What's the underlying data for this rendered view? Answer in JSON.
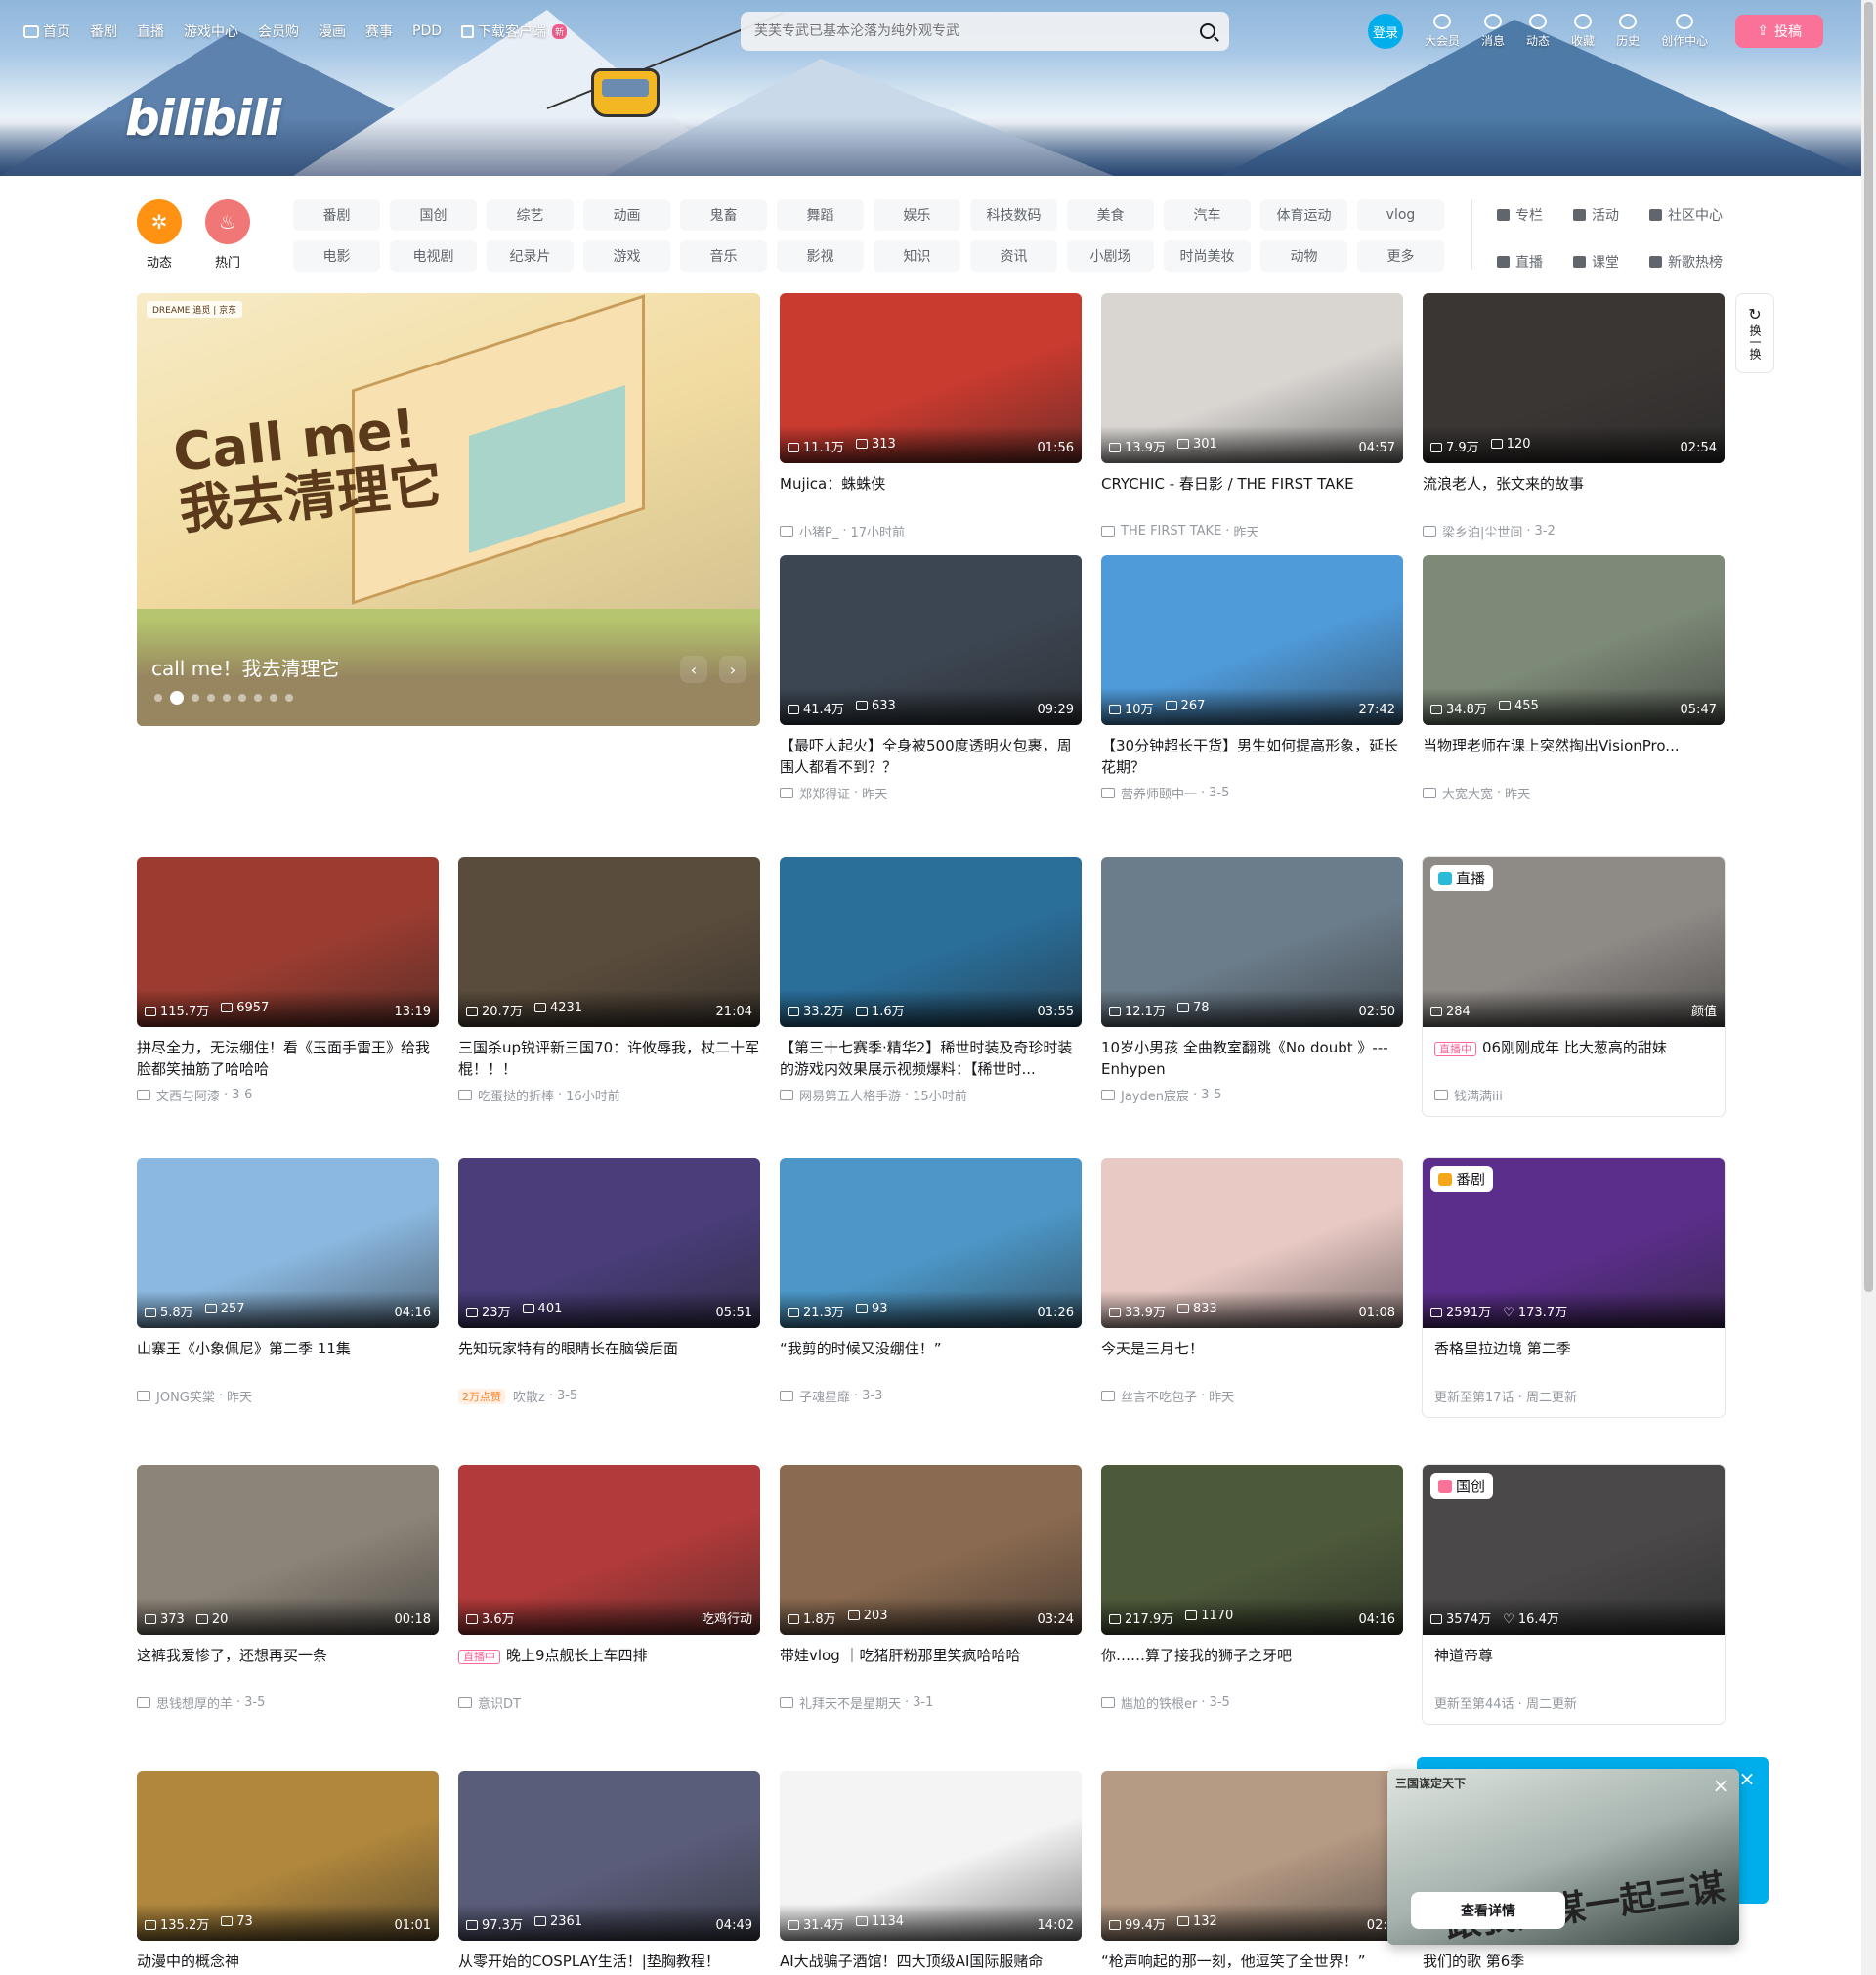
{
  "nav": {
    "items": [
      {
        "label": "首页",
        "icon": "tv-icon"
      },
      {
        "label": "番剧"
      },
      {
        "label": "直播"
      },
      {
        "label": "游戏中心"
      },
      {
        "label": "会员购"
      },
      {
        "label": "漫画"
      },
      {
        "label": "赛事"
      },
      {
        "label": "PDD"
      },
      {
        "label": "下载客户端",
        "icon": "download-icon",
        "badge": "新"
      }
    ],
    "search_placeholder": "芙芙专武已基本沦落为纯外观专武",
    "login": "登录",
    "right": [
      {
        "label": "大会员",
        "icon": "vip-icon"
      },
      {
        "label": "消息",
        "icon": "message-icon"
      },
      {
        "label": "动态",
        "icon": "dynamic-icon"
      },
      {
        "label": "收藏",
        "icon": "star-icon"
      },
      {
        "label": "历史",
        "icon": "clock-icon"
      },
      {
        "label": "创作中心",
        "icon": "bulb-icon"
      }
    ],
    "upload": "投稿",
    "logo": "bilibili"
  },
  "channels": {
    "dynamic": "动态",
    "hot": "热门",
    "row1": [
      "番剧",
      "国创",
      "综艺",
      "动画",
      "鬼畜",
      "舞蹈",
      "娱乐",
      "科技数码",
      "美食",
      "汽车",
      "体育运动",
      "vlog"
    ],
    "row2": [
      "电影",
      "电视剧",
      "纪录片",
      "游戏",
      "音乐",
      "影视",
      "知识",
      "资讯",
      "小剧场",
      "时尚美妆",
      "动物",
      "更多"
    ],
    "right": [
      "专栏",
      "活动",
      "社区中心",
      "直播",
      "课堂",
      "新歌热榜"
    ]
  },
  "carousel": {
    "title": "call me！我去清理它",
    "art_text": "Call me!\n我去清理它",
    "sponsor": "DREAME 追觅 | 京东",
    "dot_count": 9,
    "active_dot": 1,
    "prev": "‹",
    "next": "›"
  },
  "refresh": {
    "label": "换一换"
  },
  "cards": [
    {
      "title": "Mujica：蛛蛛侠",
      "views": "11.1万",
      "danmaku": "313",
      "duration": "01:56",
      "author": "小猪P_",
      "date": "17小时前",
      "color": "#c93a2f"
    },
    {
      "title": "CRYCHIC - 春日影 / THE FIRST TAKE",
      "views": "13.9万",
      "danmaku": "301",
      "duration": "04:57",
      "author": "THE FIRST TAKE",
      "date": "昨天",
      "color": "#d9d6d2"
    },
    {
      "title": "流浪老人，张文来的故事",
      "views": "7.9万",
      "danmaku": "120",
      "duration": "02:54",
      "author": "梁乡泊|尘世间",
      "date": "3-2",
      "color": "#3a3634"
    },
    {
      "title": "【最吓人起火】全身被500度透明火包裹，周围人都看不到？？",
      "views": "41.4万",
      "danmaku": "633",
      "duration": "09:29",
      "author": "郑郑得证",
      "date": "昨天",
      "color": "#3c4652"
    },
    {
      "title": "【30分钟超长干货】男生如何提高形象，延长花期？",
      "views": "10万",
      "danmaku": "267",
      "duration": "27:42",
      "author": "营养师颐中一",
      "date": "3-5",
      "color": "#4f9ad9"
    },
    {
      "title": "当物理老师在课上突然掏出VisionPro...",
      "views": "34.8万",
      "danmaku": "455",
      "duration": "05:47",
      "author": "大宽大宽",
      "date": "昨天",
      "color": "#7d8a78"
    },
    {
      "title": "拼尽全力，无法绷住！看《玉面手雷王》给我脸都笑抽筋了哈哈哈",
      "views": "115.7万",
      "danmaku": "6957",
      "duration": "13:19",
      "author": "文西与阿漆",
      "date": "3-6",
      "color": "#9c3c30"
    },
    {
      "title": "三国杀up锐评新三国70：许攸辱我，杖二十军棍！！！",
      "views": "20.7万",
      "danmaku": "4231",
      "duration": "21:04",
      "author": "吃蛋挞的折棒",
      "date": "16小时前",
      "color": "#5a4c3c"
    },
    {
      "title": "【第三十七赛季·精华2】稀世时装及奇珍时装的游戏内效果展示视频爆料：【稀世时...",
      "views": "33.2万",
      "danmaku": "1.6万",
      "duration": "03:55",
      "author": "网易第五人格手游",
      "date": "15小时前",
      "color": "#2a6e9a"
    },
    {
      "title": "10岁小男孩 全曲教室翻跳《No doubt 》---Enhypen",
      "views": "12.1万",
      "danmaku": "78",
      "duration": "02:50",
      "author": "Jayden宸宸",
      "date": "3-5",
      "color": "#6b7c8a"
    },
    {
      "kind": "live",
      "tag": "直播",
      "title": "06刚刚成年 比大葱高的甜妹",
      "live_label": "直播中",
      "views": "284",
      "right": "颜值",
      "author": "钱满满iii",
      "color": "#8e8a86"
    },
    {
      "title": "山寨王《小象佩尼》第二季 11集",
      "views": "5.8万",
      "danmaku": "257",
      "duration": "04:16",
      "author": "JONG笑棠",
      "date": "昨天",
      "color": "#8bb8e0"
    },
    {
      "title": "先知玩家特有的眼睛长在脑袋后面",
      "views": "23万",
      "danmaku": "401",
      "duration": "05:51",
      "author": "吹散z",
      "date": "3-5",
      "hot": "2万点赞",
      "color": "#4a3d7a"
    },
    {
      "title": "“我剪的时候又没绷住！”",
      "views": "21.3万",
      "danmaku": "93",
      "duration": "01:26",
      "author": "子魂星靡",
      "date": "3-3",
      "color": "#4c97c7"
    },
    {
      "title": "今天是三月七！",
      "views": "33.9万",
      "danmaku": "833",
      "duration": "01:08",
      "author": "丝言不吃包子",
      "date": "昨天",
      "color": "#e8c9c4"
    },
    {
      "kind": "bangumi",
      "tag": "番剧",
      "title": "香格里拉边境 第二季",
      "views": "2591万",
      "likes": "173.7万",
      "extra": "更新至第17话 · 周二更新",
      "color": "#5b2e8c"
    },
    {
      "title": "这裤我爱惨了，还想再买一条",
      "views": "373",
      "danmaku": "20",
      "duration": "00:18",
      "author": "思钱想厚的羊",
      "date": "3-5",
      "color": "#8c8478"
    },
    {
      "kind": "livecard",
      "title": "晚上9点舰长上车四排",
      "live_label": "直播中",
      "views": "3.6万",
      "right": "吃鸡行动",
      "author": "意识DT",
      "color": "#b23a3a"
    },
    {
      "title": "带娃vlog ｜吃猪肝粉那里笑疯哈哈哈",
      "views": "1.8万",
      "danmaku": "203",
      "duration": "03:24",
      "author": "礼拜天不是星期天",
      "date": "3-1",
      "color": "#8a6a50"
    },
    {
      "title": "你……算了接我的狮子之牙吧",
      "views": "217.9万",
      "danmaku": "1170",
      "duration": "04:16",
      "author": "尴尬的铁根er",
      "date": "3-5",
      "color": "#4d5a3a"
    },
    {
      "kind": "guochuang",
      "tag": "国创",
      "title": "神道帝尊",
      "views": "3574万",
      "likes": "16.4万",
      "extra": "更新至第44话 · 周二更新",
      "color": "#4a4848"
    },
    {
      "title": "动漫中的概念神",
      "views": "135.2万",
      "danmaku": "73",
      "duration": "01:01",
      "color": "#b0873c"
    },
    {
      "title": "从零开始的COSPLAY生活！|垫胸教程！",
      "views": "97.3万",
      "danmaku": "2361",
      "duration": "04:49",
      "color": "#5a5d7a"
    },
    {
      "title": "AI大战骗子酒馆！四大顶级AI国际服赌命",
      "views": "31.4万",
      "danmaku": "1134",
      "duration": "14:02",
      "color": "#f4f4f4"
    },
    {
      "title": "“枪声响起的那一刻，他逗笑了全世界！”",
      "views": "99.4万",
      "danmaku": "132",
      "duration": "02:1",
      "color": "#b59a84"
    },
    {
      "title": "我们的歌 第6季",
      "views": "",
      "danmaku": "",
      "duration": "",
      "color": "#ffffff"
    }
  ],
  "ad": {
    "title": "三国谋定天下",
    "art": "跟我刘谋一起三谋",
    "button": "查看详情",
    "close": "×"
  }
}
